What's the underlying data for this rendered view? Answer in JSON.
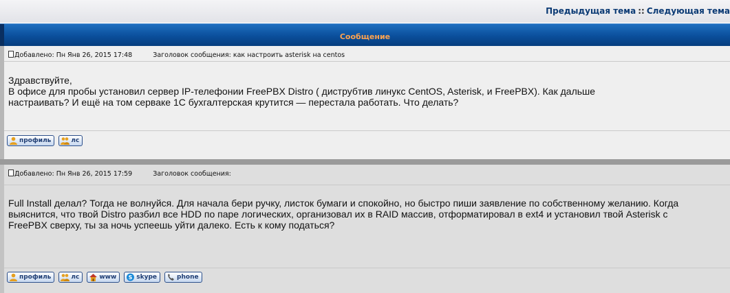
{
  "nav": {
    "prev_topic": "Предыдущая тема",
    "separator": "::",
    "next_topic": "Следующая тема"
  },
  "header": {
    "title": "Сообщение"
  },
  "posts": [
    {
      "posted_label": "Добавлено:",
      "posted_date": "Пн Янв 26, 2015 17:48",
      "subject_label": "Заголовок сообщения:",
      "subject": "как настроить asterisk на centos",
      "body": [
        "Здравствуйте,",
        "В офисе для пробы установил сервер IP-телефонии FreePBX Distro ( диструбтив линукс CentOS, Asterisk, и FreePBX). Как дальше",
        "настраивать? И ещё на том серваке 1С бухгалтерская крутится — перестала работать. Что делать?"
      ],
      "buttons": {
        "profile": "профиль",
        "pm": "лс"
      }
    },
    {
      "posted_label": "Добавлено:",
      "posted_date": "Пн Янв 26, 2015 17:59",
      "subject_label": "Заголовок сообщения:",
      "subject": "",
      "body": [
        "Full Install делал? Тогда не волнуйся. Для начала бери ручку, листок бумаги и спокойно, но быстро пиши заявление по собственному желанию. Когда",
        "выяснится, что твой Distro разбил все HDD по паре логических, организовал их в RAID массив, отформатировал в ext4 и установил твой Asterisk с",
        "FreePBX сверху, ты за ночь успеешь уйти далеко. Есть к кому податься?"
      ],
      "buttons": {
        "profile": "профиль",
        "pm": "лс",
        "www": "www",
        "skype": "skype",
        "phone": "phone"
      }
    }
  ],
  "colors": {
    "header_bg": "#0a4e9a",
    "header_text": "#ffa34f",
    "nav_link": "#0b3a74",
    "post_bg": "#efefef",
    "button_border": "#2c4f8a"
  },
  "icons": {
    "post": "post-icon",
    "profile": "user-icon",
    "pm": "users-icon",
    "www": "house-icon",
    "skype": "skype-icon",
    "phone": "phone-icon"
  }
}
